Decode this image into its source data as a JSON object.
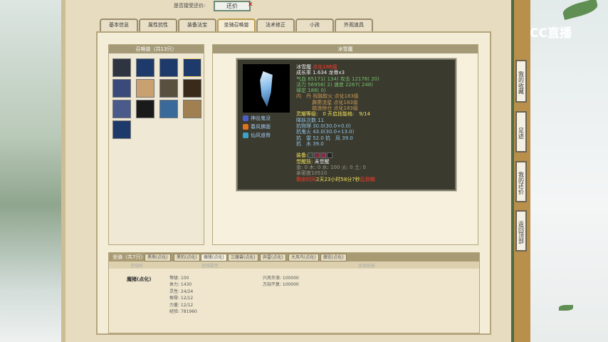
{
  "top": {
    "bargain_label": "是否接受还价:",
    "bargain_value": "还价",
    "close": "✕"
  },
  "tabs": [
    "基本信息",
    "属性抗性",
    "装备法宝",
    "坐骑召唤兽",
    "法术修正",
    "小孩",
    "外观道具"
  ],
  "active_tab": 3,
  "pets_panel": {
    "title": "召唤兽（共13只）",
    "count": 13
  },
  "pet_detail": {
    "title": "冰雪魔",
    "skills": [
      "神出鬼没",
      "春风拂面",
      "仙风道骨"
    ],
    "lines": {
      "name": "冰雪魔",
      "name_level": "点化186级",
      "growth": "成长率 1.634 龙骨x3",
      "hp": "气血 85171( 134)",
      "atk": "攻击 12176( 20)",
      "mp": "法力 56956( 2)",
      "spd": "速度 2267( 248)",
      "focus": "禅定 186( 0)",
      "neidan1": "内　丹 祝融取火 点化183级",
      "neidan2": "霹雳流星 点化183级",
      "neidan3": "踏浪除仓 点化183级",
      "spirit": "灵耀等级:　0 开启技能格:　9/14",
      "demon": "降妖次数 11",
      "res1": "抗物理 30.0(30.0+0.0)",
      "res2": "抗鬼火 43.0(30.0+13.0)",
      "res3": "抗　雷 52.0 抗　风 39.0",
      "res4": "抗　水 39.0",
      "equip_label": "装备:",
      "awaken_label": "觉醒技:",
      "awaken_value": "未觉醒",
      "elements": "金: 0 木: 0 水: 100 火: 0 土: 0",
      "intimacy": "亲密度10510",
      "time_label": "剩余时间",
      "time_value": "2天23小时58分7秒",
      "time_suffix": "后到期"
    }
  },
  "mounts": {
    "title": "坐骑（共7只）",
    "tabs": [
      "黑熊(点化)",
      "黑豹(点化)",
      "魔猪(点化)",
      "三魔兽(点化)",
      "奔雷(点化)",
      "大风鸟(点化)",
      "骤驼(点化)"
    ],
    "active_tab": 2,
    "columns": [
      "坐骑名",
      "坐骑属性",
      "坐骑技能"
    ],
    "name": "魔猪(点化)",
    "attrs": [
      "等级: 100",
      "体力: 1430",
      "灵性: 24/24",
      "根骨: 12/12",
      "力量: 12/12",
      "经验: 781960"
    ],
    "skills": [
      "兴风作浪: 100000",
      "万劫不复: 100000"
    ]
  },
  "sidebar": [
    "我的收藏",
    "足迹",
    "我的还价",
    "返回顶部"
  ],
  "logo": "CC直播",
  "colors": {
    "page": "#e7dcc0",
    "card": "#3b3a2f",
    "accent": "#b98f4c"
  }
}
